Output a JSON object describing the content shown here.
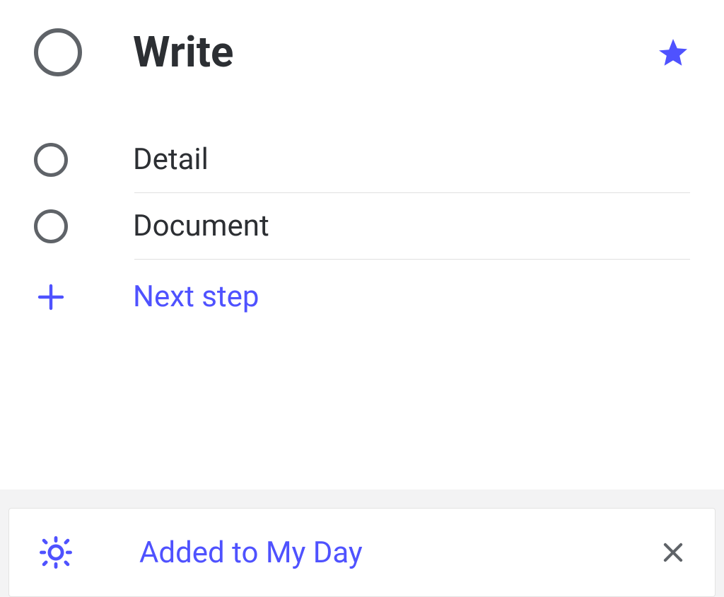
{
  "task": {
    "title": "Write",
    "starred": true
  },
  "steps": [
    {
      "label": "Detail",
      "completed": false
    },
    {
      "label": "Document",
      "completed": false
    }
  ],
  "next_step_label": "Next step",
  "my_day": {
    "label": "Added to My Day"
  },
  "colors": {
    "accent": "#4f52ff",
    "text": "#2c2f33",
    "muted": "#5f6368"
  }
}
